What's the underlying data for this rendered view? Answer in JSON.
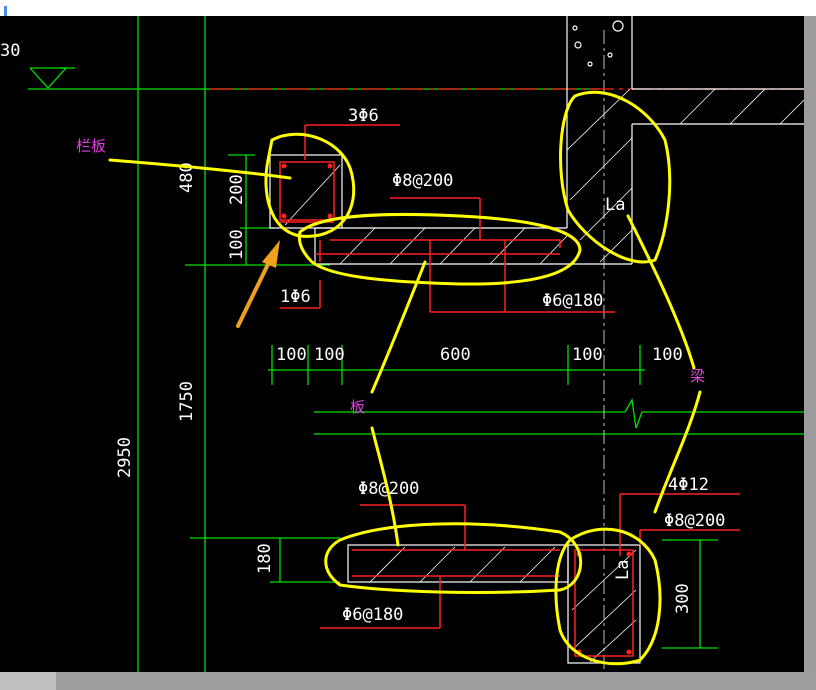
{
  "drawing": {
    "top_left_fragment": "30",
    "dims": {
      "rebar_3phi6": "3Φ6",
      "h480": "480",
      "h200": "200",
      "h100": "100",
      "phi8_200_top": "Φ8@200",
      "rebar_1phi6": "1Φ6",
      "phi6_180_top": "Φ6@180",
      "w100a": "100",
      "w100b": "100",
      "w600": "600",
      "w100c": "100",
      "w100d": "100",
      "h1750": "1750",
      "h2950": "2950",
      "phi8_200_mid": "Φ8@200",
      "rebar_4phi12": "4Φ12",
      "phi8_200_right": "Φ8@200",
      "h180": "180",
      "phi6_180_bottom": "Φ6@180",
      "h300": "300",
      "la_top": "La",
      "la_bottom": "La"
    },
    "labels": {
      "lanban": "栏板",
      "ban": "板",
      "liang": "梁"
    }
  },
  "colors": {
    "background": "#000000",
    "dim_line": "#00e000",
    "text": "#ffffff",
    "rebar": "#ff2020",
    "outline": "#ffffff",
    "annotation": "#ffff00",
    "label": "#e040e0",
    "arrow": "#f0a020"
  }
}
